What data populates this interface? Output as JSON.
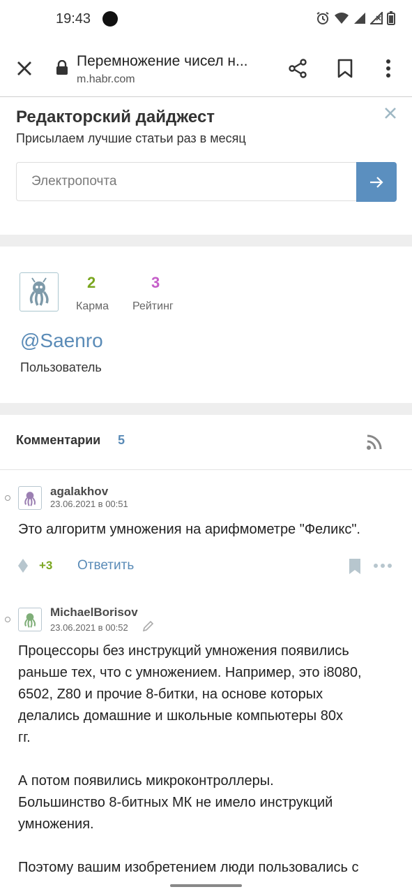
{
  "status_bar": {
    "time": "19:43"
  },
  "browser": {
    "page_title": "Перемножение чисел н...",
    "domain": "m.habr.com",
    "icons": [
      "close-icon",
      "lock-icon",
      "share-icon",
      "bookmark-icon",
      "more-vert-icon"
    ]
  },
  "digest": {
    "title": "Редакторский дайджест",
    "subtitle": "Присылаем лучшие статьи раз в месяц",
    "email_placeholder": "Электропочта"
  },
  "profile": {
    "karma_value": "2",
    "karma_label": "Карма",
    "rating_value": "3",
    "rating_label": "Рейтинг",
    "username": "@Saenro",
    "role": "Пользователь"
  },
  "comments": {
    "label": "Комментарии",
    "count": "5",
    "items": [
      {
        "author": "agalakhov",
        "date": "23.06.2021 в 00:51",
        "text": "Это алгоритм умножения на арифмометре \"Феликс\".",
        "score": "+3",
        "reply": "Ответить"
      },
      {
        "author": "MichaelBorisov",
        "date": "23.06.2021 в 00:52",
        "text_lines": [
          "Процессоры без инструкций умножения появились",
          "раньше тех, что с умножением. Например, это i8080,",
          "6502, Z80 и прочие 8-битки, на основе которых",
          "делались домашние и школьные компьютеры 80х",
          "гг.",
          "",
          "А потом появились микроконтроллеры.",
          "Большинство 8-битных МК не имело инструкций",
          "умножения.",
          "",
          "Поэтому вашим изобретением люди пользовались с"
        ]
      }
    ]
  },
  "colors": {
    "accent": "#5b8fbf",
    "karma": "#7aa61f",
    "rating": "#c55ec9",
    "score": "#7aa61f",
    "link": "#5a8bb7"
  }
}
